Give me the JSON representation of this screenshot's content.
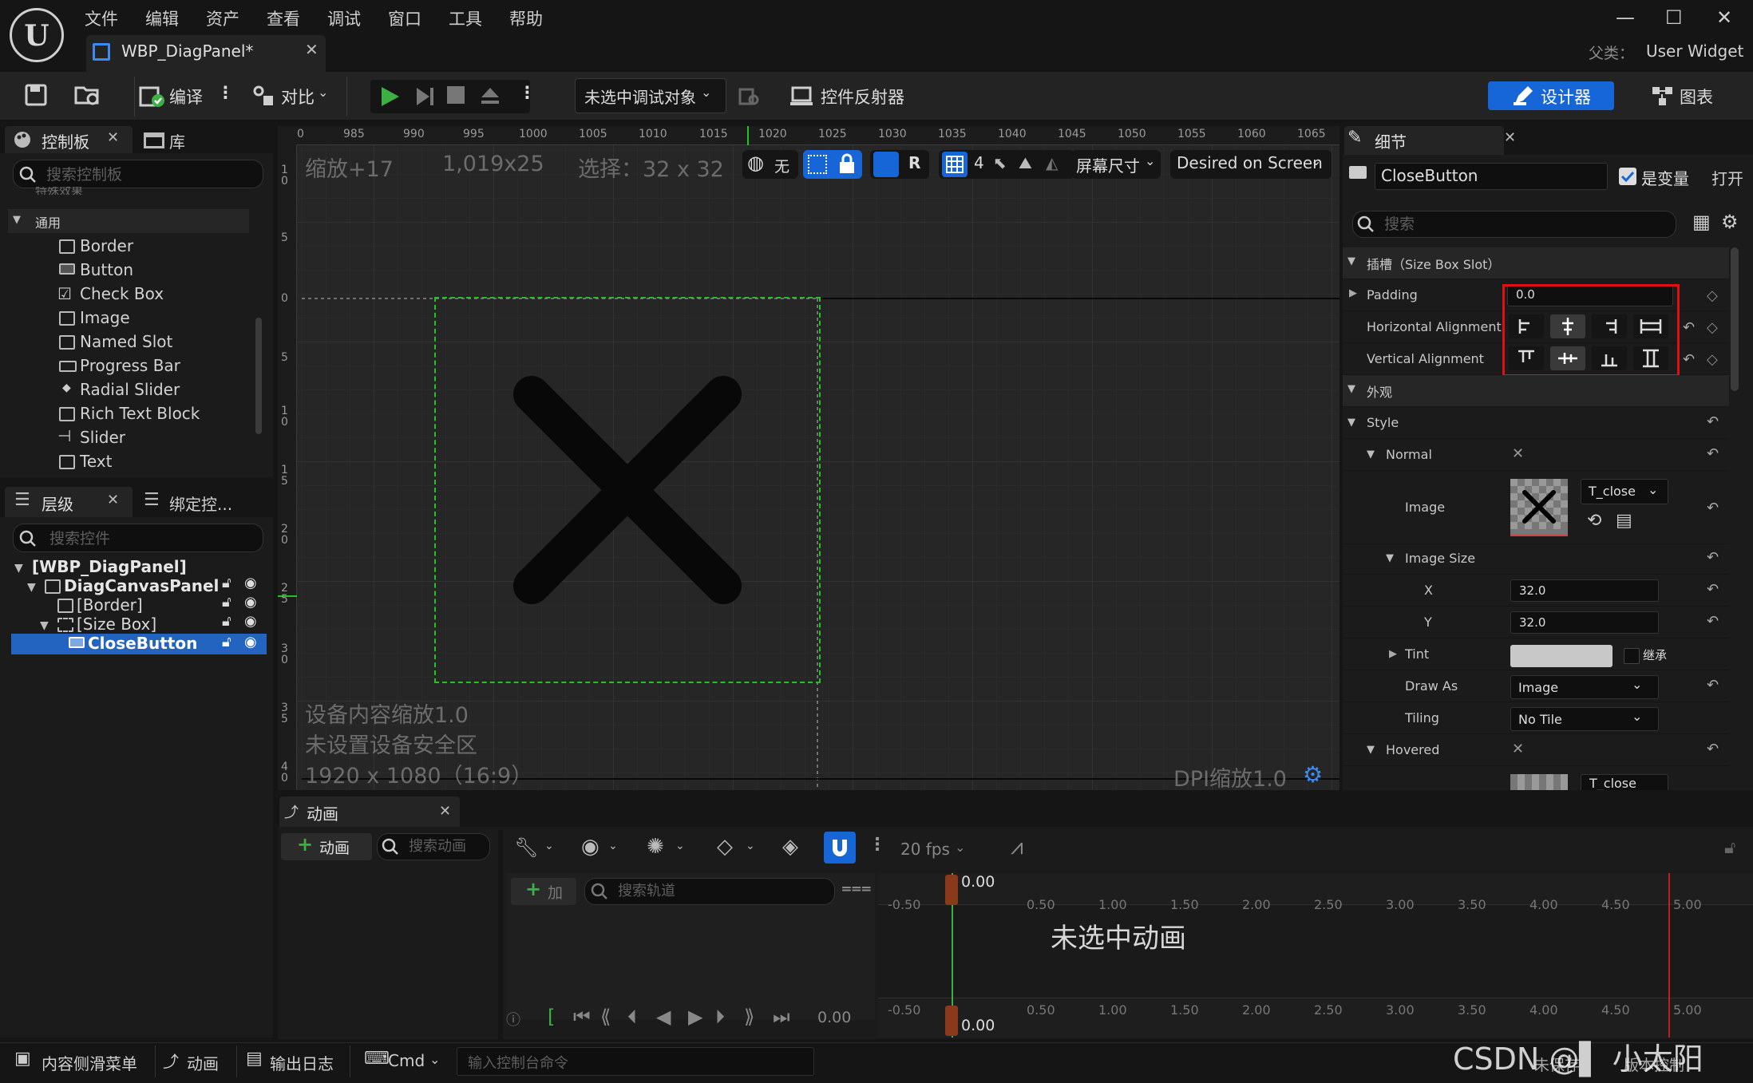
{
  "titlebar": {
    "menu": [
      "文件",
      "编辑",
      "资产",
      "查看",
      "调试",
      "窗口",
      "工具",
      "帮助"
    ],
    "doc_tab": "WBP_DiagPanel*",
    "parent_label": "父类：",
    "parent_value": "User Widget",
    "minimize": "—",
    "maximize": "☐",
    "close": "✕"
  },
  "toolbar": {
    "compile": "编译",
    "diff": "对比",
    "debug_select": "未选中调试对象",
    "reflector": "控件反射器",
    "designer": "设计器",
    "graph": "图表"
  },
  "palette": {
    "tab": "控制板",
    "library_tab": "库",
    "search_placeholder": "搜索控制板",
    "partial_category": "特殊效果",
    "category": "通用",
    "items": [
      "Border",
      "Button",
      "Check Box",
      "Image",
      "Named Slot",
      "Progress Bar",
      "Radial Slider",
      "Rich Text Block",
      "Slider",
      "Text"
    ]
  },
  "hierarchy": {
    "tab": "层级",
    "bind_tab": "绑定控...",
    "search_placeholder": "搜索控件",
    "nodes": [
      "[WBP_DiagPanel]",
      "DiagCanvasPanel",
      "[Border]",
      "[Size Box]",
      "CloseButton"
    ]
  },
  "viewport": {
    "zoom": "缩放+17",
    "coords": "1,019x25",
    "selection": "选择：32 x 32",
    "btn_none": "无",
    "btn_r": "R",
    "btn_4": "4",
    "screen_size": "屏幕尺寸",
    "desired": "Desired on Screen",
    "device_scale": "设备内容缩放1.0",
    "safe_zone": "未设置设备安全区",
    "resolution": "1920 x 1080（16:9）",
    "dpi": "DPI缩放1.0",
    "ruler_top": [
      "0",
      "985",
      "990",
      "995",
      "1000",
      "1005",
      "1010",
      "1015",
      "1020",
      "1025",
      "1030",
      "1035",
      "1040",
      "1045",
      "1050",
      "1055",
      "1060",
      "1065"
    ],
    "ruler_left": [
      "1\n0",
      "5",
      "0",
      "5",
      "1\n0",
      "1\n5",
      "2\n0",
      "2\n5",
      "3\n0",
      "3\n5",
      "4\n0"
    ]
  },
  "details": {
    "tab": "细节",
    "widget_name": "CloseButton",
    "is_variable": "是变量",
    "open": "打开",
    "search_placeholder": "搜索",
    "slot_section": "插槽（Size Box Slot）",
    "padding_label": "Padding",
    "padding_value": "0.0",
    "h_align_label": "Horizontal Alignment",
    "v_align_label": "Vertical Alignment",
    "appearance_section": "外观",
    "style_label": "Style",
    "normal_label": "Normal",
    "image_label": "Image",
    "image_asset": "T_close",
    "image_size_label": "Image Size",
    "x_label": "X",
    "x_value": "32.0",
    "y_label": "Y",
    "y_value": "32.0",
    "tint_label": "Tint",
    "inherit": "继承",
    "draw_as_label": "Draw As",
    "draw_as_value": "Image",
    "tiling_label": "Tiling",
    "tiling_value": "No Tile",
    "hovered_label": "Hovered",
    "hovered_asset": "T_close"
  },
  "animation": {
    "tab": "动画",
    "add_anim": "动画",
    "search_anim_placeholder": "搜索动画",
    "add_track": "加",
    "search_track_placeholder": "搜索轨道",
    "fps": "20 fps",
    "time_top": "0.00",
    "time_bottom": "0.00",
    "time_field": "0.00",
    "no_anim": "未选中动画",
    "ticks": [
      "-0.50",
      "0.50",
      "1.00",
      "1.50",
      "2.00",
      "2.50",
      "3.00",
      "3.50",
      "4.00",
      "4.50",
      "5.00"
    ]
  },
  "statusbar": {
    "content_drawer": "内容侧滑菜单",
    "anim": "动画",
    "output_log": "输出日志",
    "cmd": "Cmd",
    "console_placeholder": "输入控制台命令",
    "unsaved": "未保存",
    "version": "版本控制",
    "watermark": "CSDN @▌ 小太阳"
  },
  "colors": {
    "accent_blue": "#1766d8",
    "selection_green": "#22c322",
    "highlight_red": "#e01010"
  }
}
